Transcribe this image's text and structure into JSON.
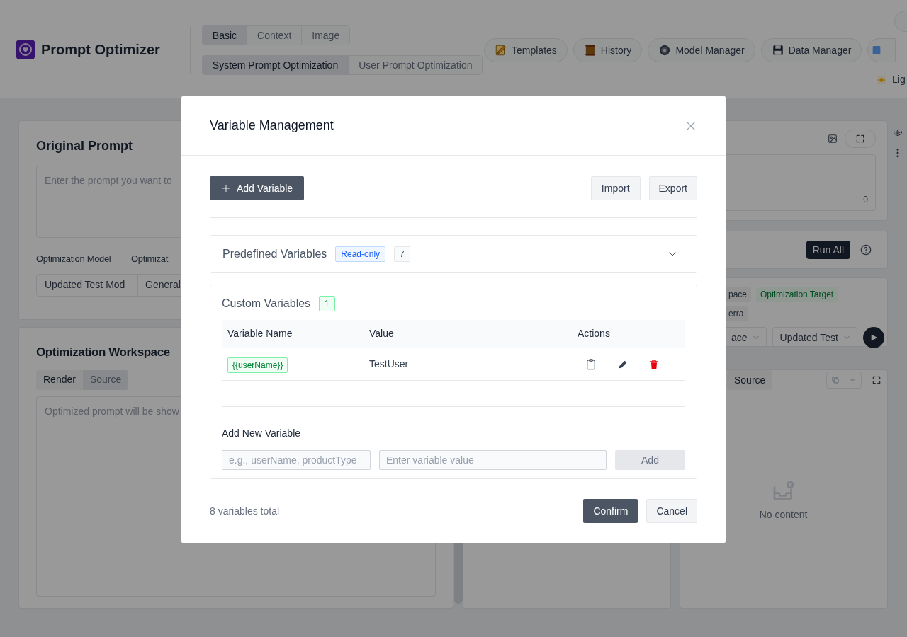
{
  "header": {
    "app_name": "Prompt Optimizer",
    "mode_tabs": [
      {
        "label": "Basic",
        "selected": true
      },
      {
        "label": "Context",
        "selected": false
      },
      {
        "label": "Image",
        "selected": false
      }
    ],
    "prompt_tabs": [
      {
        "label": "System Prompt Optimization",
        "selected": true
      },
      {
        "label": "User Prompt Optimization",
        "selected": false
      }
    ],
    "nav_buttons": [
      "Templates",
      "History",
      "Model Manager",
      "Data Manager"
    ],
    "theme_label": "Lig"
  },
  "original_prompt": {
    "title": "Original Prompt",
    "placeholder": "Enter the prompt you want to",
    "model_label": "Optimization Model",
    "template_label": "Optimizat",
    "model_value": "Updated Test Mod",
    "template_value": "General"
  },
  "workspace": {
    "title": "Optimization Workspace",
    "view_tabs": [
      {
        "label": "Render",
        "selected": true
      },
      {
        "label": "Source",
        "selected": false
      }
    ],
    "placeholder": "Optimized prompt will be show"
  },
  "test_panel": {
    "char_count": "0",
    "run_all": "Run All",
    "tags": [
      {
        "label": "pace",
        "kind": "neutral"
      },
      {
        "label": "Optimization Target",
        "kind": "target"
      },
      {
        "label": "erra",
        "kind": "neutral"
      }
    ],
    "selects": [
      "ace",
      "Updated Test"
    ],
    "result_tab": "Source",
    "empty_text": "No content"
  },
  "dialog": {
    "title": "Variable Management",
    "add_button": "Add Variable",
    "import": "Import",
    "export": "Export",
    "predefined": {
      "title": "Predefined Variables",
      "badge": "Read-only",
      "count": "7",
      "expanded": false
    },
    "custom": {
      "title": "Custom Variables",
      "count": "1",
      "columns": [
        "Variable Name",
        "Value",
        "Actions"
      ],
      "rows": [
        {
          "name": "{{userName}}",
          "value": "TestUser"
        }
      ]
    },
    "add_new": {
      "title": "Add New Variable",
      "name_placeholder": "e.g., userName, productType",
      "value_placeholder": "Enter variable value",
      "add": "Add",
      "disabled": true
    },
    "total": "8 variables total",
    "confirm": "Confirm",
    "cancel": "Cancel"
  }
}
